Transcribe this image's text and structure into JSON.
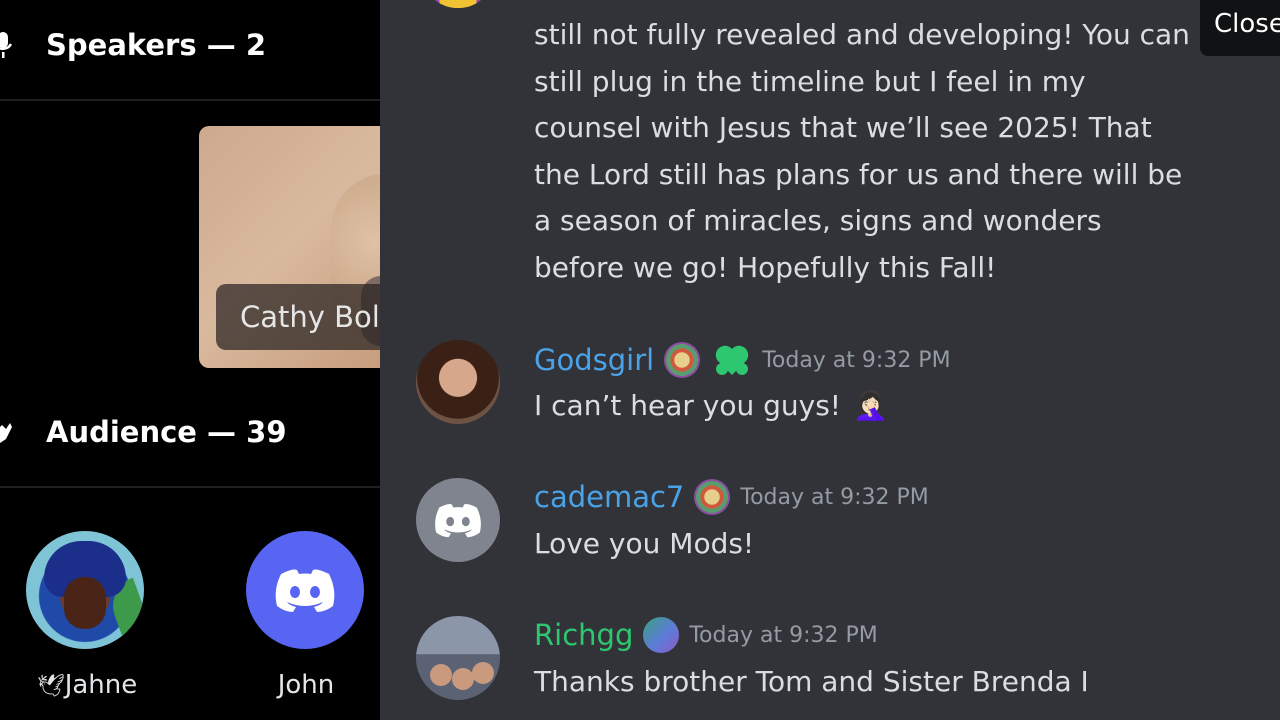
{
  "stage": {
    "speakers_label": "Speakers — 2",
    "audience_label": "Audience — 39",
    "speaker_card": {
      "name": "Cathy Bol"
    },
    "audience": [
      {
        "name": "Jahne",
        "prefix_icon": "dove-icon"
      },
      {
        "name": "John"
      }
    ]
  },
  "chat": {
    "close_label": "Close",
    "previous_message_text": "still not fully revealed and developing! You can still plug in the timeline but I feel in my counsel with Jesus that we’ll see 2025! That the Lord still has plans for us and there will be a season of miracles, signs and wonders before we go! Hopefully this Fall!",
    "messages": [
      {
        "username": "Godsgirl",
        "username_color": "#00a8fc",
        "timestamp": "Today at 9:32 PM",
        "text": "I can’t hear you guys!",
        "emoji": "facepalm-emoji"
      },
      {
        "username": "cademac7",
        "username_color": "#00a8fc",
        "timestamp": "Today at 9:32 PM",
        "text": "Love you Mods!"
      },
      {
        "username": "Richgg",
        "username_color": "#2dc770",
        "timestamp": "Today at 9:32 PM",
        "text": "Thanks brother Tom and Sister Brenda I"
      }
    ]
  },
  "colors": {
    "blurple": "#5865f2",
    "chat_bg": "#313338",
    "stage_bg": "#000000"
  }
}
